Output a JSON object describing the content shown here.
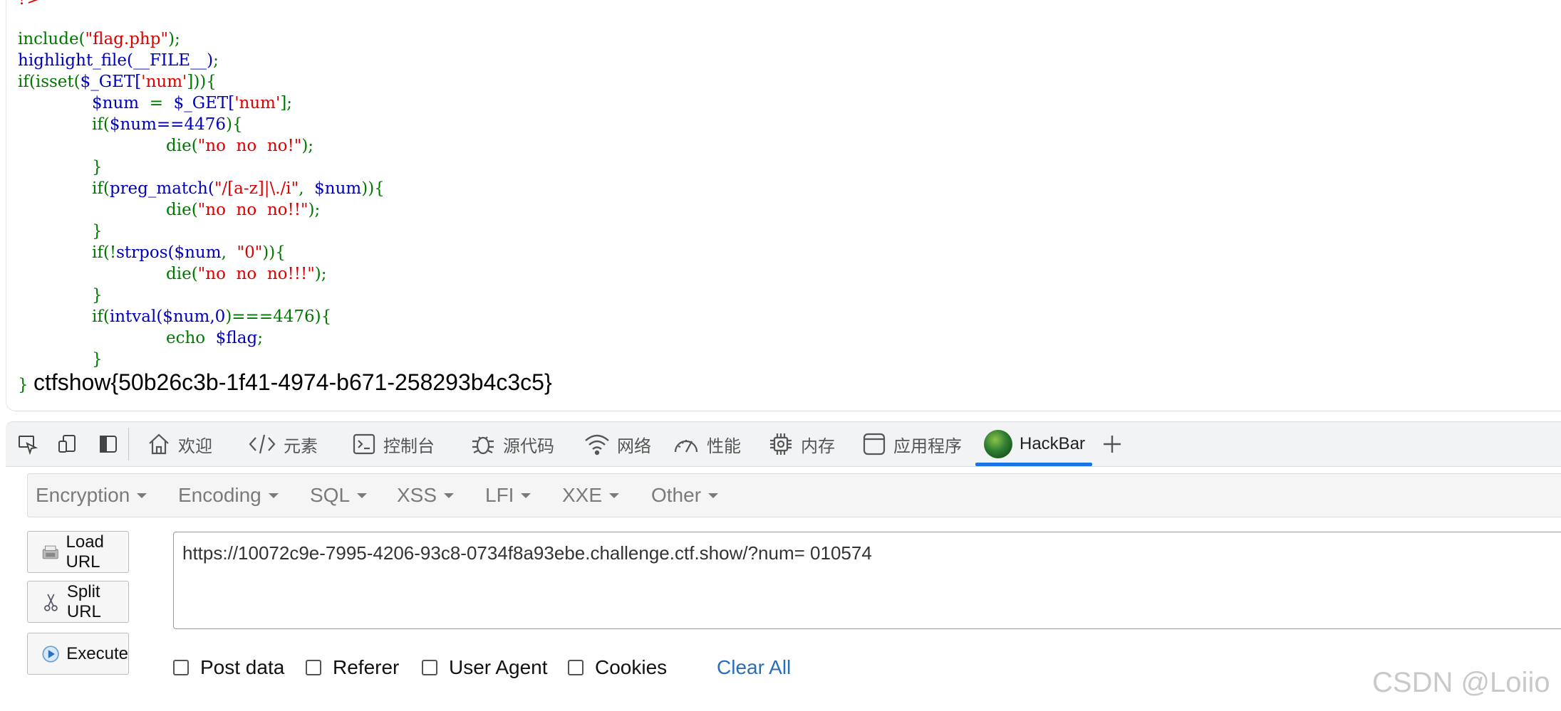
{
  "code": {
    "top_fragment": "?>",
    "line_include_fn": "include(",
    "line_include_str": "\"flag.php\"",
    "line_include_end": ");",
    "line_highlight_fn": "highlight_file(__FILE__)",
    "line_highlight_end": ";",
    "line_if_isset_k": "if(isset(",
    "line_if_isset_var": "$_GET[",
    "line_if_isset_str": "'num'",
    "line_if_isset_end": "])){",
    "line_num_var": "$num",
    "line_num_eq": "  =  ",
    "line_num_get": "$_GET[",
    "line_num_str": "'num'",
    "line_num_end": "];",
    "line_if1_k": "if(",
    "line_if1_cond": "$num==4476",
    "line_if1_end": "){",
    "line_die1_k": "die(",
    "line_die1_str": "\"no  no  no!\"",
    "line_die1_end": ");",
    "close1": "}",
    "line_if2_k": "if(",
    "line_if2_fn": "preg_match(",
    "line_if2_str": "\"/[a-z]|\\./i\"",
    "line_if2_sep": ",  ",
    "line_if2_var": "$num",
    "line_if2_end": ")){",
    "line_die2_k": "die(",
    "line_die2_str": "\"no  no  no!!\"",
    "line_die2_end": ");",
    "close2": "}",
    "line_if3_k": "if(!",
    "line_if3_fn": "strpos(",
    "line_if3_var": "$num",
    "line_if3_sep": ",  ",
    "line_if3_str": "\"0\"",
    "line_if3_end": ")){",
    "line_die3_k": "die(",
    "line_die3_str": "\"no  no  no!!!\"",
    "line_die3_end": ");",
    "close3": "}",
    "line_if4_k": "if(",
    "line_if4_fn": "intval(",
    "line_if4_args": "$num,0",
    "line_if4_cmp": ")===4476",
    "line_if4_end": "){",
    "line_echo_k": "echo  ",
    "line_echo_var": "$flag",
    "line_echo_end": ";",
    "close4": "}",
    "close_outer": "}",
    "flag_output": "ctfshow{50b26c3b-1f41-4974-b671-258293b4c3c5}"
  },
  "devtools": {
    "tabs": [
      {
        "label": "欢迎",
        "icon": "home-icon"
      },
      {
        "label": "元素",
        "icon": "code-icon"
      },
      {
        "label": "控制台",
        "icon": "console-icon"
      },
      {
        "label": "源代码",
        "icon": "bug-icon"
      },
      {
        "label": "网络",
        "icon": "wifi-icon"
      },
      {
        "label": "性能",
        "icon": "gauge-icon"
      },
      {
        "label": "内存",
        "icon": "chip-icon"
      },
      {
        "label": "应用程序",
        "icon": "app-window-icon"
      },
      {
        "label": "HackBar",
        "icon": "hackbar-logo-icon"
      }
    ],
    "active_tab": "HackBar",
    "accent_color": "#1a73e8"
  },
  "hackbar": {
    "menu": [
      "Encryption",
      "Encoding",
      "SQL",
      "XSS",
      "LFI",
      "XXE",
      "Other"
    ],
    "load_url_label": "Load URL",
    "split_url_label": "Split URL",
    "execute_label": "Execute",
    "url_value": "https://10072c9e-7995-4206-93c8-0734f8a93ebe.challenge.ctf.show/?num= 010574",
    "options": [
      "Post data",
      "Referer",
      "User Agent",
      "Cookies"
    ],
    "clear_all_label": "Clear All",
    "link_color": "#2a6ebb"
  },
  "watermark": "CSDN @Loiio"
}
